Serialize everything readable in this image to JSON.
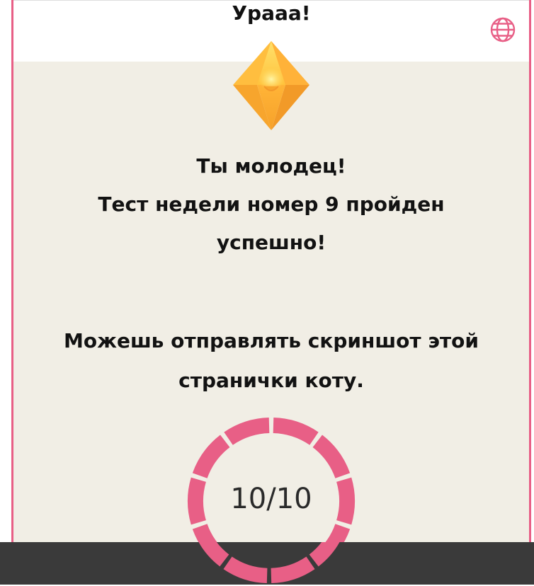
{
  "header": {
    "title": "Урааа!",
    "language_icon": "globe-icon"
  },
  "badge": {
    "icon": "diamond-gem-icon",
    "colors": {
      "light": "#ffe16b",
      "mid": "#ffc23c",
      "dark": "#f3a02a",
      "shadow": "#ff9f3e"
    }
  },
  "message": {
    "line1": "Ты молодец!",
    "line2": "Тест недели номер 9 пройден",
    "line3": "успешно!"
  },
  "instruction": {
    "line1": "Можешь отправлять скриншот этой",
    "line2": "странички коту."
  },
  "score": {
    "text": "10/10",
    "correct": 10,
    "total": 10
  },
  "colors": {
    "accent": "#e85f86",
    "background": "#f1eee5",
    "bottom_bar": "#3a3a3a"
  }
}
